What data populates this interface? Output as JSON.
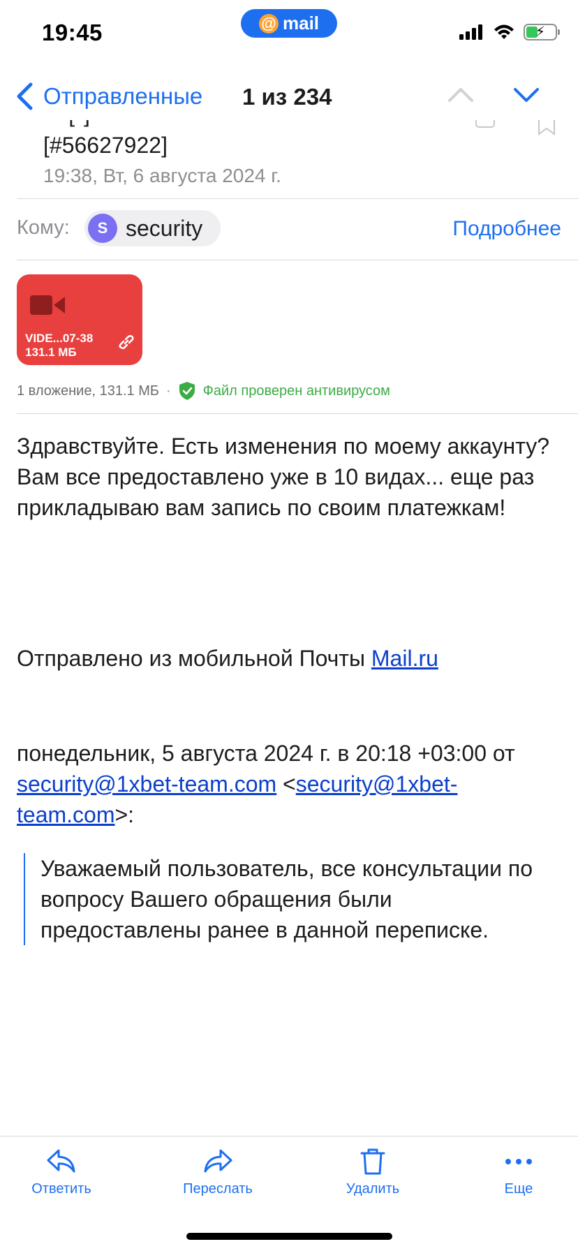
{
  "status_bar": {
    "time": "19:45",
    "app_pill": "mail",
    "app_pill_symbol": "@"
  },
  "nav": {
    "back_label": "Отправленные",
    "counter": "1 из 234"
  },
  "message": {
    "subject_visible": "[#56627922]",
    "date": "19:38, Вт, 6 августа 2024 г.",
    "to_label": "Кому:",
    "recipient_initial": "S",
    "recipient_name": "security",
    "details_link": "Подробнее"
  },
  "attachment": {
    "name": "VIDE...07-38",
    "size": "131.1 МБ",
    "summary": "1 вложение, 131.1 МБ",
    "separator": "·",
    "antivirus": "Файл проверен антивирусом"
  },
  "body": {
    "text": "Здравствуйте. Есть изменения по моему аккаунту? Вам все предоставлено уже в 10 видах... еще раз прикладываю вам запись по своим платежкам!",
    "sent_from_prefix": "Отправлено из мобильной Почты ",
    "sent_from_link": "Mail.ru",
    "quote_header_prefix": "понедельник, 5 августа 2024 г. в 20:18 +03:00 от ",
    "quote_email": "security@1xbet-team.com",
    "quote_lt": " <",
    "quote_email_2": "security@1xbet-team.com",
    "quote_gt": ">:",
    "quote_text": "Уважаемый пользователь, все консультации по вопросу Вашего обращения были предоставлены ранее в данной переписке."
  },
  "toolbar": {
    "reply": "Ответить",
    "forward": "Переслать",
    "delete": "Удалить",
    "more": "Еще"
  },
  "colors": {
    "accent": "#1d6ff0",
    "attachment_bg": "#e8403f",
    "verified": "#3aac45",
    "avatar": "#7b6ff2"
  }
}
